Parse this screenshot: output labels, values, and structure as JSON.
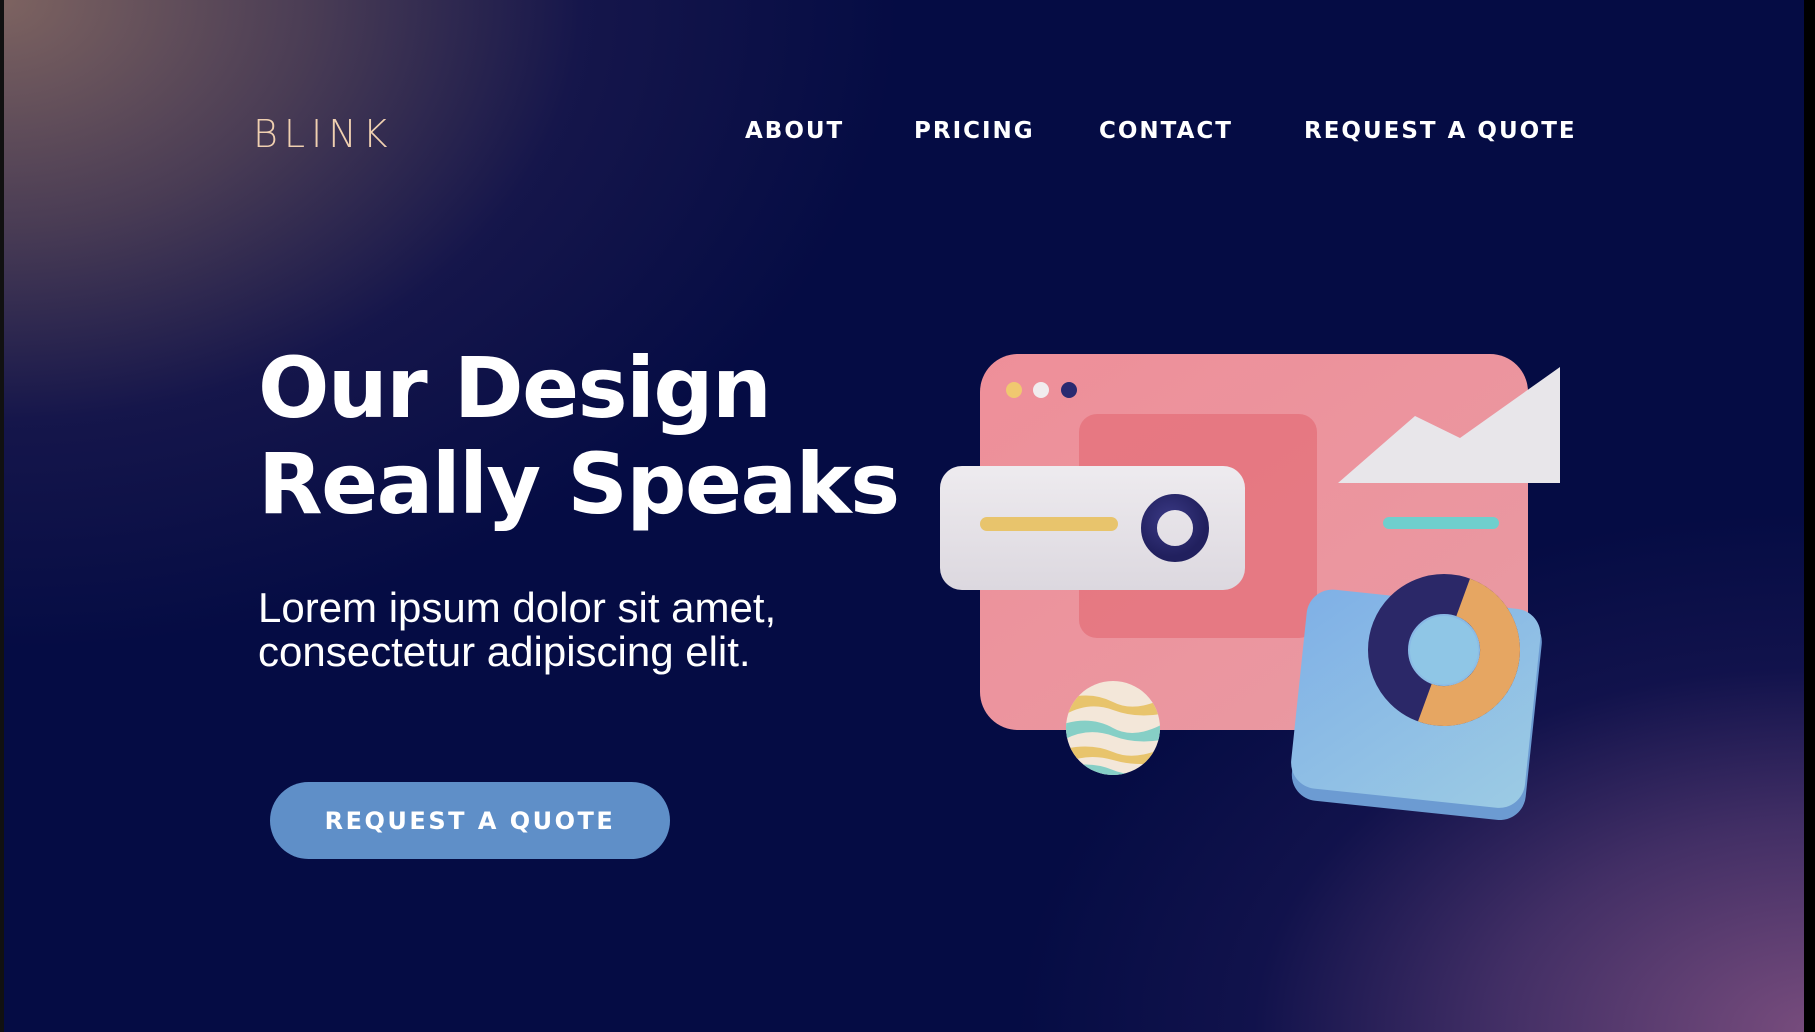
{
  "brand": {
    "logo_text": "BLINK"
  },
  "nav": {
    "items": [
      {
        "label": "ABOUT"
      },
      {
        "label": "PRICING"
      },
      {
        "label": "CONTACT"
      },
      {
        "label": "REQUEST A QUOTE"
      }
    ]
  },
  "hero": {
    "title_line1": "Our Design",
    "title_line2": "Really Speaks",
    "subtitle_line1": "Lorem ipsum dolor sit amet,",
    "subtitle_line2": "consectetur adipiscing elit.",
    "cta_label": "REQUEST A QUOTE"
  },
  "theme": {
    "background": "#050c44",
    "logo_color": "#f0d0b0",
    "cta_color": "#5f8fc8",
    "illustration_card": "#ea8c96",
    "illustration_panel": "#e9e6ec",
    "illustration_tile": "#8ebde3"
  },
  "illustration": {
    "icons": [
      "browser-window-icon",
      "mountain-chart-icon",
      "donut-chart-icon",
      "striped-ball-icon",
      "ring-icon"
    ]
  }
}
